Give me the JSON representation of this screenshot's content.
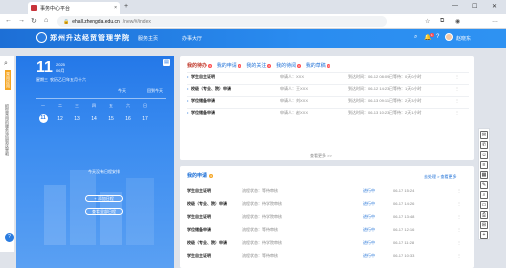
{
  "browser": {
    "tab_title": "事务中心平台",
    "tab_close": "×",
    "new_tab": "+",
    "url_host": "ehall.zhengda.edu.cn",
    "url_path": "/new/#/index",
    "win_min": "—",
    "win_max": "☐",
    "win_close": "✕"
  },
  "header": {
    "logo_text": "郑州升达经贸管理学院",
    "nav": [
      "服务主页",
      "办事大厅"
    ],
    "username": "赵晓东",
    "notif_count": "1"
  },
  "left_strip": {
    "tab_label": "常用应用",
    "hint": "把您常用的服务添加到这里吧"
  },
  "calendar": {
    "day": "11",
    "month_year": "2025",
    "month": "06月",
    "weekday": "星期三",
    "lunar": "农历乙巳年五月十六",
    "today_label": "今天",
    "today_btn": "回到今天",
    "week_headers": [
      "一",
      "二",
      "三",
      "四",
      "五",
      "六",
      "日"
    ],
    "week_days": [
      "11",
      "12",
      "13",
      "14",
      "15",
      "16",
      "17"
    ],
    "no_event": "今天没有日程安排",
    "add_btn": "+ 添加日程",
    "view_btn": "查看全部日程"
  },
  "tasks": {
    "tabs": [
      {
        "label": "我的待办",
        "count": "4"
      },
      {
        "label": "我的申请",
        "count": "4"
      },
      {
        "label": "我的关注",
        "count": "0"
      },
      {
        "label": "我的待阅",
        "count": "0"
      },
      {
        "label": "我的草稿",
        "count": "0"
      }
    ],
    "rows": [
      {
        "title": "学生自主证明",
        "applicant": "申请人：XXX",
        "time": "到达时间：06-12 08:09",
        "wait": "已等待：0天0小时",
        "more": "⋮"
      },
      {
        "title": "校级（专业、院）申请",
        "applicant": "申请人：王XXX",
        "time": "到达时间：06-12 14:23",
        "wait": "已等待：1天0小时",
        "more": "⋮"
      },
      {
        "title": "学位储备申请",
        "applicant": "申请人：刘XXX",
        "time": "到达时间：06-13 09:11",
        "wait": "已等待：2天3小时",
        "more": "⋮"
      },
      {
        "title": "学位储备申请",
        "applicant": "申请人：赵XXX",
        "time": "到达时间：06-13 10:23",
        "wait": "已等待：2天1小时",
        "more": "⋮"
      }
    ],
    "load_more": "查看更多 >>"
  },
  "applications": {
    "title": "我的申请",
    "count": "4",
    "link": "去处理 > 查看更多",
    "rows": [
      {
        "title": "学生自主证明",
        "sid": "流程状态：等待审核",
        "status": "进行中",
        "date": "06-17 15:24",
        "more": "⋮"
      },
      {
        "title": "校级（专业、院）申请",
        "sid": "流程状态：待学院审核",
        "status": "进行中",
        "date": "06-17 14:26",
        "more": "⋮"
      },
      {
        "title": "学生自主证明",
        "sid": "流程状态：待学院审核",
        "status": "进行中",
        "date": "06-17 13:48",
        "more": "⋮"
      },
      {
        "title": "学位储备申请",
        "sid": "流程状态：等待审核",
        "status": "进行中",
        "date": "06-17 12:16",
        "more": "⋮"
      },
      {
        "title": "校级（专业、院）申请",
        "sid": "流程状态：待学院审核",
        "status": "进行中",
        "date": "06-17 11:28",
        "more": "⋮"
      },
      {
        "title": "学生自主证明",
        "sid": "流程状态：等待审核",
        "status": "进行中",
        "date": "06-17 10:33",
        "more": "⋮"
      }
    ]
  },
  "right_tools": [
    "chat-icon",
    "mail-icon",
    "user-icon",
    "list-icon",
    "calendar-icon",
    "edit-icon",
    "search-icon",
    "doc-icon",
    "printer-icon",
    "grid-icon",
    "plus-icon"
  ],
  "colors": {
    "primary": "#2478e8",
    "alert": "#ff4d4f",
    "accent": "#f5a623"
  }
}
